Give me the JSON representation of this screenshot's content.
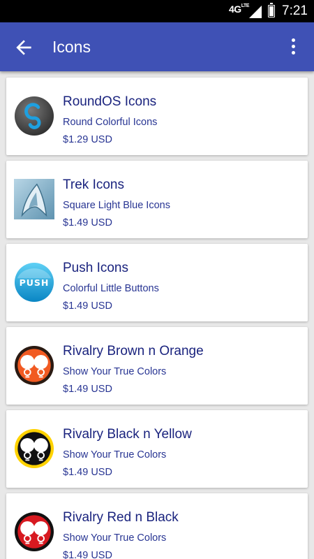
{
  "status_bar": {
    "network": "4G",
    "network_sub": "LTE",
    "time": "7:21",
    "battery_level": 0.85
  },
  "app_bar": {
    "title": "Icons",
    "back_icon": "arrow-left-icon",
    "menu_icon": "more-vert-icon"
  },
  "items": [
    {
      "name": "RoundOS Icons",
      "description": "Round Colorful Icons",
      "price": "$1.29 USD",
      "icon": "roundos-app-icon"
    },
    {
      "name": "Trek Icons",
      "description": "Square Light Blue Icons",
      "price": "$1.49 USD",
      "icon": "trek-app-icon"
    },
    {
      "name": "Push Icons",
      "description": "Colorful Little Buttons",
      "price": "$1.49 USD",
      "icon": "push-app-icon",
      "icon_text": "PUSH"
    },
    {
      "name": "Rivalry Brown n Orange",
      "description": "Show Your True Colors",
      "price": "$1.49 USD",
      "icon": "rivalry-brown-orange-app-icon"
    },
    {
      "name": "Rivalry Black n Yellow",
      "description": "Show Your True Colors",
      "price": "$1.49 USD",
      "icon": "rivalry-black-yellow-app-icon"
    },
    {
      "name": "Rivalry Red n Black",
      "description": "Show Your True Colors",
      "price": "$1.49 USD",
      "icon": "rivalry-red-black-app-icon"
    }
  ],
  "colors": {
    "primary": "#3f51b5",
    "text": "#1a237e",
    "background": "#e8e8e8"
  }
}
